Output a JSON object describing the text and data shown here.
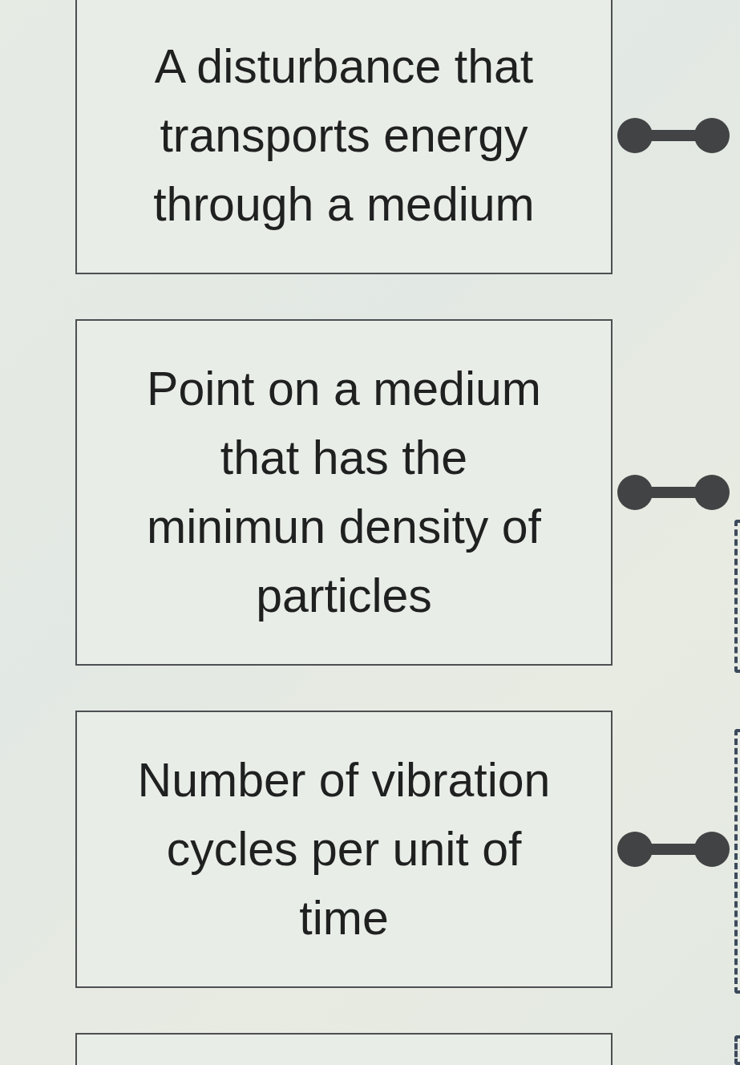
{
  "cards": [
    {
      "kind": "prompt",
      "text": "A disturbance that transports energy through a medium"
    },
    {
      "kind": "prompt",
      "text": "Point on a medium that has the minimun density of particles"
    },
    {
      "kind": "prompt",
      "text": "Number of vibration cycles per unit of time"
    },
    {
      "kind": "cut_off"
    }
  ]
}
